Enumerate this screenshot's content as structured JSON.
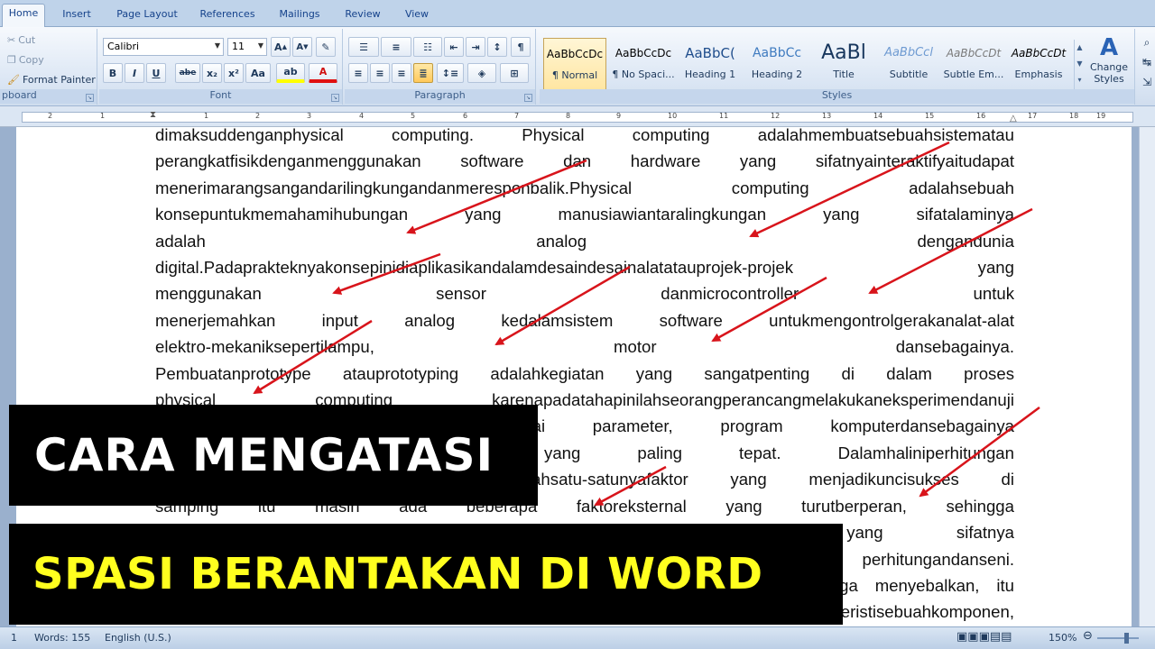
{
  "tabs": [
    "Home",
    "Insert",
    "Page Layout",
    "References",
    "Mailings",
    "Review",
    "View"
  ],
  "clipboard": {
    "cut": "Cut",
    "copy": "Copy",
    "format_painter": "Format Painter",
    "label": "pboard"
  },
  "font": {
    "name": "Calibri",
    "size": "11",
    "label": "Font",
    "bold": "B",
    "italic": "I",
    "underline": "U",
    "strike": "abe",
    "sub": "x₂",
    "sup": "x²",
    "case": "Aa"
  },
  "paragraph": {
    "label": "Paragraph"
  },
  "styles": {
    "label": "Styles",
    "change_styles": [
      "Change",
      "Styles"
    ],
    "items": [
      {
        "sample": "AaBbCcDc",
        "name": "¶ Normal"
      },
      {
        "sample": "AaBbCcDc",
        "name": "¶ No Spaci..."
      },
      {
        "sample": "AaBbC(",
        "name": "Heading 1"
      },
      {
        "sample": "AaBbCc",
        "name": "Heading 2"
      },
      {
        "sample": "AaBl",
        "name": "Title"
      },
      {
        "sample": "AaBbCcl",
        "name": "Subtitle"
      },
      {
        "sample": "AaBbCcDt",
        "name": "Subtle Em..."
      },
      {
        "sample": "AaBbCcDt",
        "name": "Emphasis"
      }
    ]
  },
  "ruler_numbers": [
    "2",
    "1",
    "1",
    "2",
    "3",
    "4",
    "5",
    "6",
    "7",
    "8",
    "9",
    "10",
    "11",
    "12",
    "13",
    "14",
    "15",
    "16",
    "17",
    "18",
    "19"
  ],
  "document": {
    "lines": [
      "dimaksuddenganphysical computing. Physical computing adalahmembuatsebuahsistematau",
      "perangkatfisikdenganmenggunakan software dan hardware yang sifatnyainteraktifyaitudapat",
      "menerimarangsangandarilingkungandanmeresponbalik.Physical computing adalahsebuah",
      "konsepuntukmemahamihubungan yang manusiawiantaralingkungan yang sifatalaminya",
      "adalah analog dengandunia",
      "digital.Padaprakteknyakonsepinidiaplikasikandalamdesaindesainalatatauprojek-projek yang",
      "menggunakan sensor danmicrocontroller untuk",
      "menerjemahkan input analog kedalamsistem software untukmengontrolgerakanalat-alat",
      "elektro-mekaniksepertilampu, motor dansebagainya.",
      "Pembuatanprototype atauprototyping adalahkegiatan yang sangatpenting di dalam proses",
      "physical computing karenapadatahapinilahseorangperancangmelakukaneksperimendanuji",
      "coba rancangan terhadap berbagai parameter, program komputerdansebagainya",
      "untuk mendapatkan kombinasi yang paling tepat. Dalamhaliniperhitungan",
      "ketelitian komponen merupakan salahsatu-satunyafaktor yang menjadikuncisukses di",
      "samping itu masih ada beberapa faktoreksternal yang turutberperan, sehingga",
      "proses mencobadanmenyusun/mengerakansebelumnyamelibatkanhal-hal yang sifatnya",
      "analisis yang merupakan perpaduan antara seni perhitungandanseni.",
      "Sehingga proses ini kadang menjadi pekerjaan yang menyenangkan tetapi juga menyebalkan, itu",
      "kadang tergantung pada prosesnya juga sangatbergantung pada karakteristisebuahkomponen,"
    ]
  },
  "overlay": {
    "line1": "CARA MENGATASI",
    "line2": "SPASI BERANTAKAN DI WORD",
    "arrow_color": "#d8141b"
  },
  "status": {
    "page": "1",
    "words": "Words: 155",
    "language": "English (U.S.)",
    "zoom": "150%"
  }
}
